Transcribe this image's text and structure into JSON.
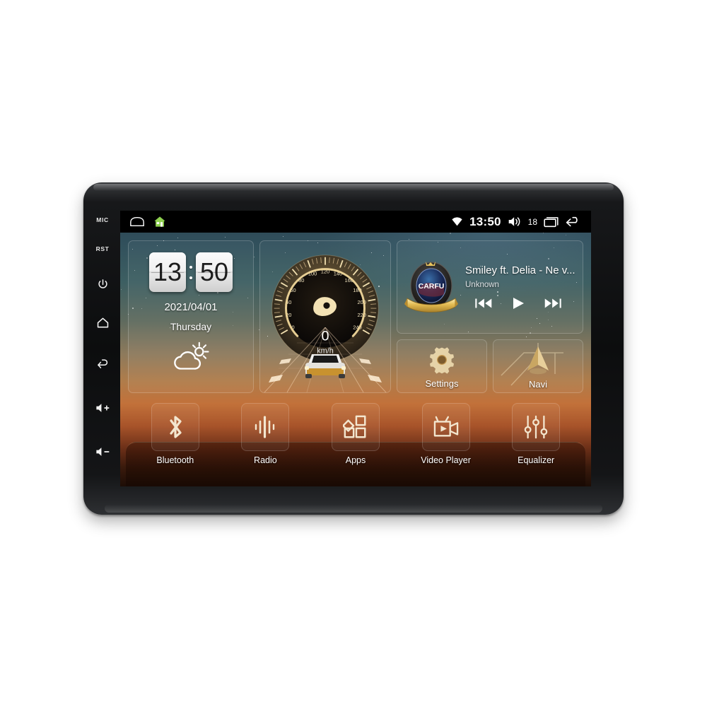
{
  "device": {
    "bezel_keys": [
      {
        "name": "mic",
        "label": "MIC",
        "type": "text"
      },
      {
        "name": "reset",
        "label": "RST",
        "type": "text"
      },
      {
        "name": "power",
        "label": "power-icon",
        "type": "icon"
      },
      {
        "name": "home",
        "label": "home-icon",
        "type": "icon"
      },
      {
        "name": "back",
        "label": "back-icon",
        "type": "icon"
      },
      {
        "name": "volume-up",
        "label": "volume-up-icon",
        "type": "icon"
      },
      {
        "name": "volume-down",
        "label": "volume-down-icon",
        "type": "icon"
      }
    ]
  },
  "statusbar": {
    "left_icons": [
      "tunnel-icon",
      "home-green-icon"
    ],
    "wifi_icon": "wifi-icon",
    "time": "13:50",
    "volume_icon": "volume-icon",
    "volume_level": "18",
    "recents_icon": "recents-icon",
    "back_icon": "back-icon"
  },
  "clock_widget": {
    "hours": "13",
    "minutes": "50",
    "date": "2021/04/01",
    "weekday": "Thursday",
    "weather_icon": "partly-cloudy-icon"
  },
  "speed_widget": {
    "value": "0",
    "unit": "km/h",
    "ticks": [
      "0",
      "20",
      "40",
      "60",
      "80",
      "100",
      "120",
      "140",
      "160",
      "180",
      "200",
      "220",
      "240"
    ],
    "min": 0,
    "max": 240
  },
  "media_widget": {
    "album_art_text": "CARFU",
    "title": "Smiley ft. Delia - Ne v...",
    "artist": "Unknown",
    "prev_label": "previous-track",
    "play_label": "play",
    "next_label": "next-track"
  },
  "tiles": [
    {
      "label": "Settings",
      "icon": "gear-icon"
    },
    {
      "label": "Navi",
      "icon": "navigation-arrow-icon"
    }
  ],
  "dock": [
    {
      "label": "Bluetooth",
      "icon": "bluetooth-icon"
    },
    {
      "label": "Radio",
      "icon": "radio-waves-icon"
    },
    {
      "label": "Apps",
      "icon": "apps-grid-icon"
    },
    {
      "label": "Video Player",
      "icon": "video-camera-icon"
    },
    {
      "label": "Equalizer",
      "icon": "equalizer-sliders-icon"
    }
  ],
  "colors": {
    "accent_gold": "#e8d3a0",
    "sky_top": "#2b4351",
    "sunset": "#c2713a",
    "status_bg": "#000000"
  }
}
